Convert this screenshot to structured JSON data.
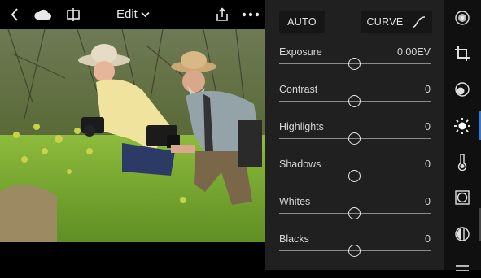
{
  "topbar": {
    "icons": [
      "back-chevron-icon",
      "cloud-icon",
      "compare-icon",
      "share-icon",
      "more-icon"
    ],
    "edit_label": "Edit"
  },
  "panel": {
    "auto_label": "AUTO",
    "curve_label": "CURVE",
    "sliders": [
      {
        "label": "Exposure",
        "value": "0.00EV",
        "position": 0.5
      },
      {
        "label": "Contrast",
        "value": "0",
        "position": 0.5
      },
      {
        "label": "Highlights",
        "value": "0",
        "position": 0.5
      },
      {
        "label": "Shadows",
        "value": "0",
        "position": 0.5
      },
      {
        "label": "Whites",
        "value": "0",
        "position": 0.5
      },
      {
        "label": "Blacks",
        "value": "0",
        "position": 0.5
      }
    ]
  },
  "tool_rail": {
    "items": [
      "presets-icon",
      "crop-icon",
      "selective-icon",
      "light-icon",
      "color-temperature-icon",
      "vignette-icon",
      "detail-icon"
    ],
    "active": "light-icon",
    "active_color": "#2f7bd6"
  }
}
